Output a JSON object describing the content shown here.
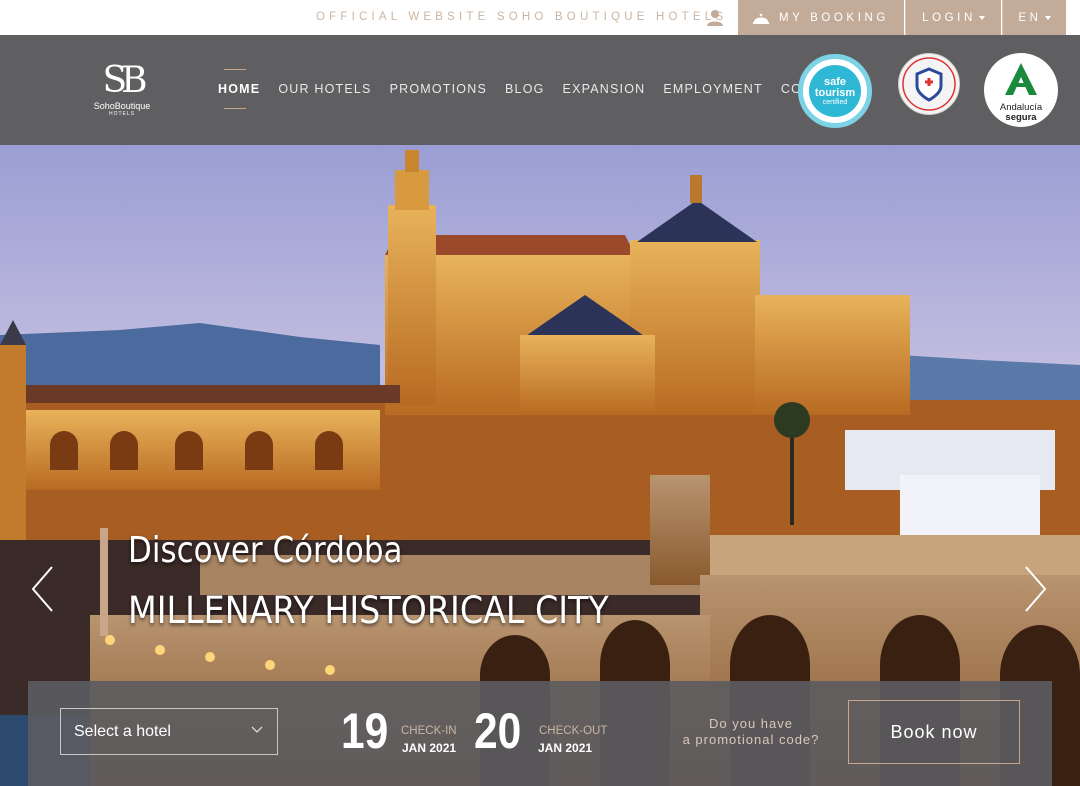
{
  "topbar": {
    "official_text": "OFFICIAL WEBSITE SOHO BOUTIQUE HOTELS",
    "my_booking": "MY BOOKING",
    "login": "LOGIN",
    "language": "EN",
    "accent_color": "#c3ab99"
  },
  "logo": {
    "mark": "SB",
    "name": "SohoBoutique",
    "sub": "HOTELS"
  },
  "nav": {
    "items": [
      "HOME",
      "OUR HOTELS",
      "PROMOTIONS",
      "BLOG",
      "EXPANSION",
      "EMPLOYMENT",
      "CONTACT"
    ],
    "active_index": 0
  },
  "badges": {
    "safe_tourism": {
      "line1": "safe",
      "line2": "tourism",
      "line3": "certified"
    },
    "andalucia": {
      "line1": "Andalucía",
      "line2": "segura"
    }
  },
  "hero": {
    "title": "Discover Córdoba",
    "subtitle": "MILLENARY HISTORICAL CITY"
  },
  "booking": {
    "hotel_select": "Select a hotel",
    "checkin": {
      "day": "19",
      "label": "CHECK-IN",
      "month": "JAN 2021"
    },
    "checkout": {
      "day": "20",
      "label": "CHECK-OUT",
      "month": "JAN 2021"
    },
    "promo_line1": "Do you have",
    "promo_line2": "a promotional code?",
    "book_now": "Book now"
  }
}
